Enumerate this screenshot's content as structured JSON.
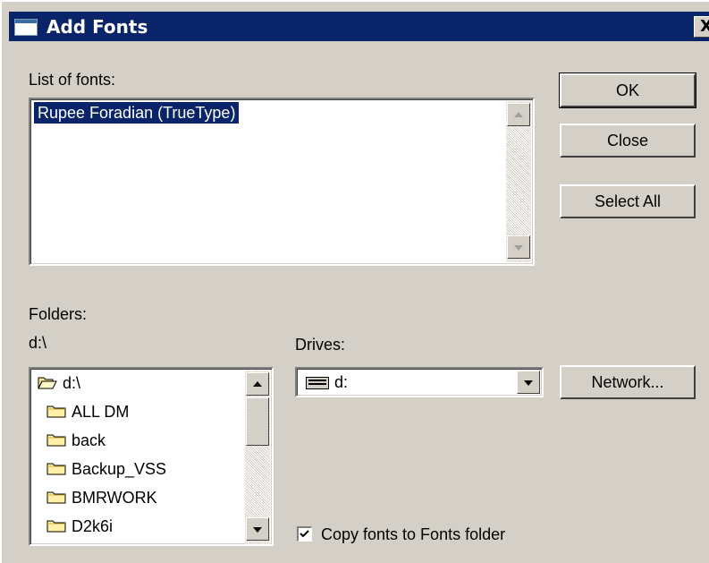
{
  "window": {
    "title": "Add Fonts",
    "close_glyph": "X"
  },
  "fonts_list": {
    "label": "List of fonts:",
    "items": [
      "Rupee Foradian (TrueType)"
    ],
    "selected_index": 0
  },
  "buttons": {
    "ok": "OK",
    "close": "Close",
    "select_all": "Select All",
    "network": "Network..."
  },
  "folders": {
    "label": "Folders:",
    "current_path": "d:\\",
    "items": [
      {
        "name": "d:\\",
        "icon": "open-folder-icon"
      },
      {
        "name": "ALL DM",
        "icon": "folder-icon"
      },
      {
        "name": "back",
        "icon": "folder-icon"
      },
      {
        "name": "Backup_VSS",
        "icon": "folder-icon"
      },
      {
        "name": "BMRWORK",
        "icon": "folder-icon"
      },
      {
        "name": "D2k6i",
        "icon": "folder-icon"
      }
    ]
  },
  "drives": {
    "label": "Drives:",
    "selected": "d:",
    "icon": "drive-icon"
  },
  "copy_option": {
    "label": "Copy fonts to Fonts folder",
    "checked": true
  },
  "colors": {
    "titlebar": "#0a246a",
    "dialog_face": "#d4d0c8",
    "selection": "#0a246a"
  }
}
